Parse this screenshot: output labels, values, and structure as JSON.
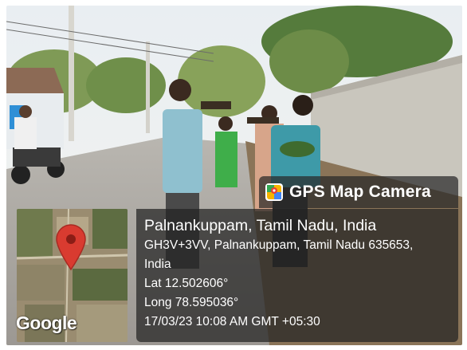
{
  "badge": {
    "app_name": "GPS Map Camera",
    "icon": "map-camera-icon"
  },
  "map": {
    "provider_logo": "Google",
    "pin_icon": "location-pin-icon"
  },
  "location": {
    "place": "Palnankuppam, Tamil Nadu, India",
    "address_line1": "GH3V+3VV, Palnankuppam, Tamil Nadu 635653,",
    "address_line2": "India",
    "latitude": "Lat 12.502606°",
    "longitude": "Long 78.595036°",
    "timestamp": "17/03/23 10:08 AM GMT +05:30"
  },
  "colors": {
    "pin_red": "#d93b30",
    "overlay_dark": "#232323"
  }
}
